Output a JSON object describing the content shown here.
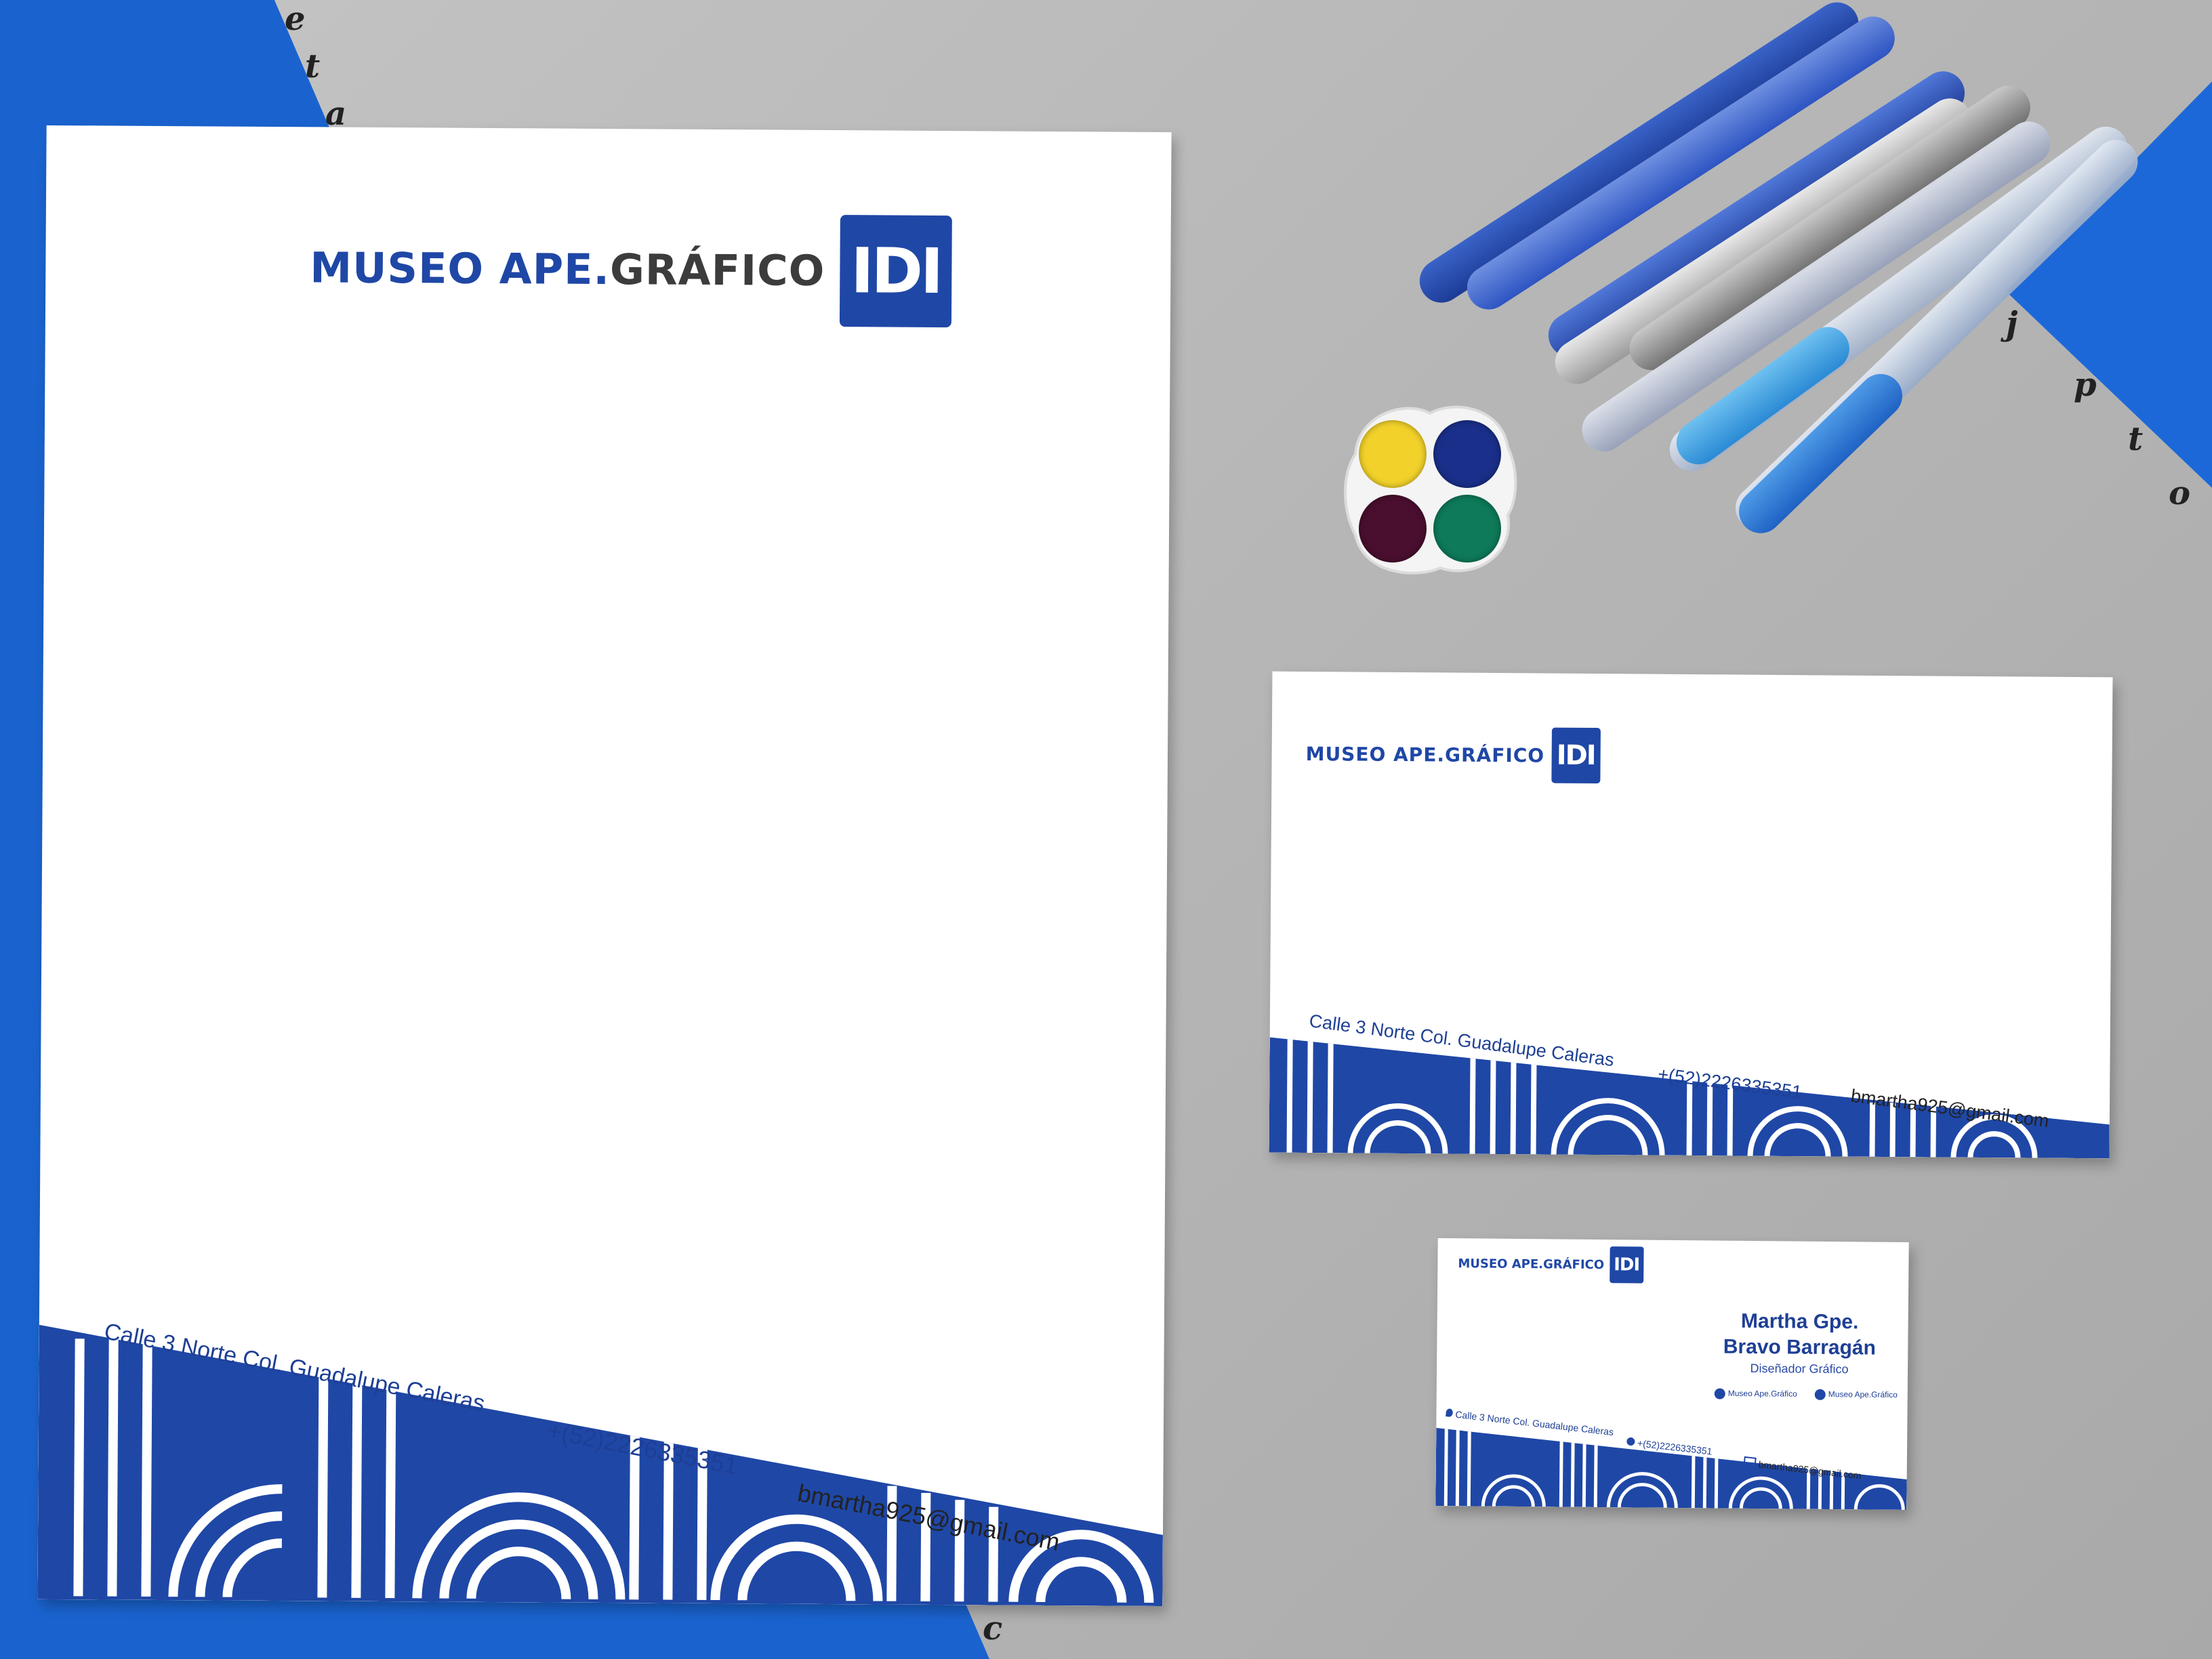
{
  "brand": {
    "name_part1": "MUSEO APE.",
    "name_part2": "GRÁFICO",
    "logo_label": "IDI",
    "color_primary": "#1f47a6",
    "color_text_dark": "#3c3c3c"
  },
  "background": {
    "edge_letters_top": [
      "e",
      "t",
      "a"
    ],
    "edge_letters_right": [
      "j",
      "p",
      "t",
      "o"
    ],
    "edge_letter_bottom": "c",
    "blue": "#1a63cf",
    "grey": "#bdbdbd"
  },
  "letterhead": {
    "address": "Calle 3 Norte Col. Guadalupe Caleras",
    "phone": "+(52)2226335351",
    "email": "bmartha925@gmail.com"
  },
  "envelope": {
    "address": "Calle 3 Norte Col. Guadalupe Caleras",
    "phone": "+(52)2226335351",
    "email": "bmartha925@gmail.com"
  },
  "business_card": {
    "name_line1": "Martha Gpe.",
    "name_line2": "Bravo Barragán",
    "role": "Diseñador Gráfico",
    "social_1": "Museo Ape.Gráfico",
    "social_2": "Museo Ape.Gráfico",
    "address": "Calle 3 Norte Col. Guadalupe Caleras",
    "phone": "+(52)2226335351",
    "email": "bmartha925@gmail.com"
  },
  "palette_colors": [
    "#f2d22a",
    "#1a2f8a",
    "#4a0f2e",
    "#0e7a5a"
  ]
}
